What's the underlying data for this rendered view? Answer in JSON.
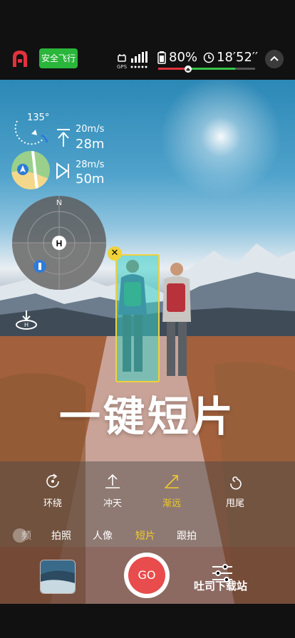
{
  "status": {
    "safe_flight_label": "安全飞行",
    "gps_label": "GPS",
    "battery_text": "80%",
    "time_remaining": "18′52′′"
  },
  "hud": {
    "heading": "135°",
    "vertical_speed": "20m/s",
    "height": "28m",
    "horizontal_speed": "28m/s",
    "distance": "50m",
    "radar_north": "N",
    "radar_home": "H"
  },
  "title": "一键短片",
  "modes": [
    {
      "label": "环绕",
      "icon": "orbit-icon"
    },
    {
      "label": "冲天",
      "icon": "rocket-icon"
    },
    {
      "label": "渐远",
      "icon": "dronie-icon"
    },
    {
      "label": "甩尾",
      "icon": "spiral-icon"
    }
  ],
  "active_mode_index": 2,
  "categories": [
    {
      "label": "拍照"
    },
    {
      "label": "人像"
    },
    {
      "label": "短片"
    },
    {
      "label": "跟拍"
    }
  ],
  "category_partial": "频",
  "active_category_index": 2,
  "go_label": "GO",
  "watermark": "吐司下载站",
  "colors": {
    "accent_yellow": "#f2cb2d",
    "safe_green": "#2ab53b",
    "go_red": "#e84c4c"
  }
}
